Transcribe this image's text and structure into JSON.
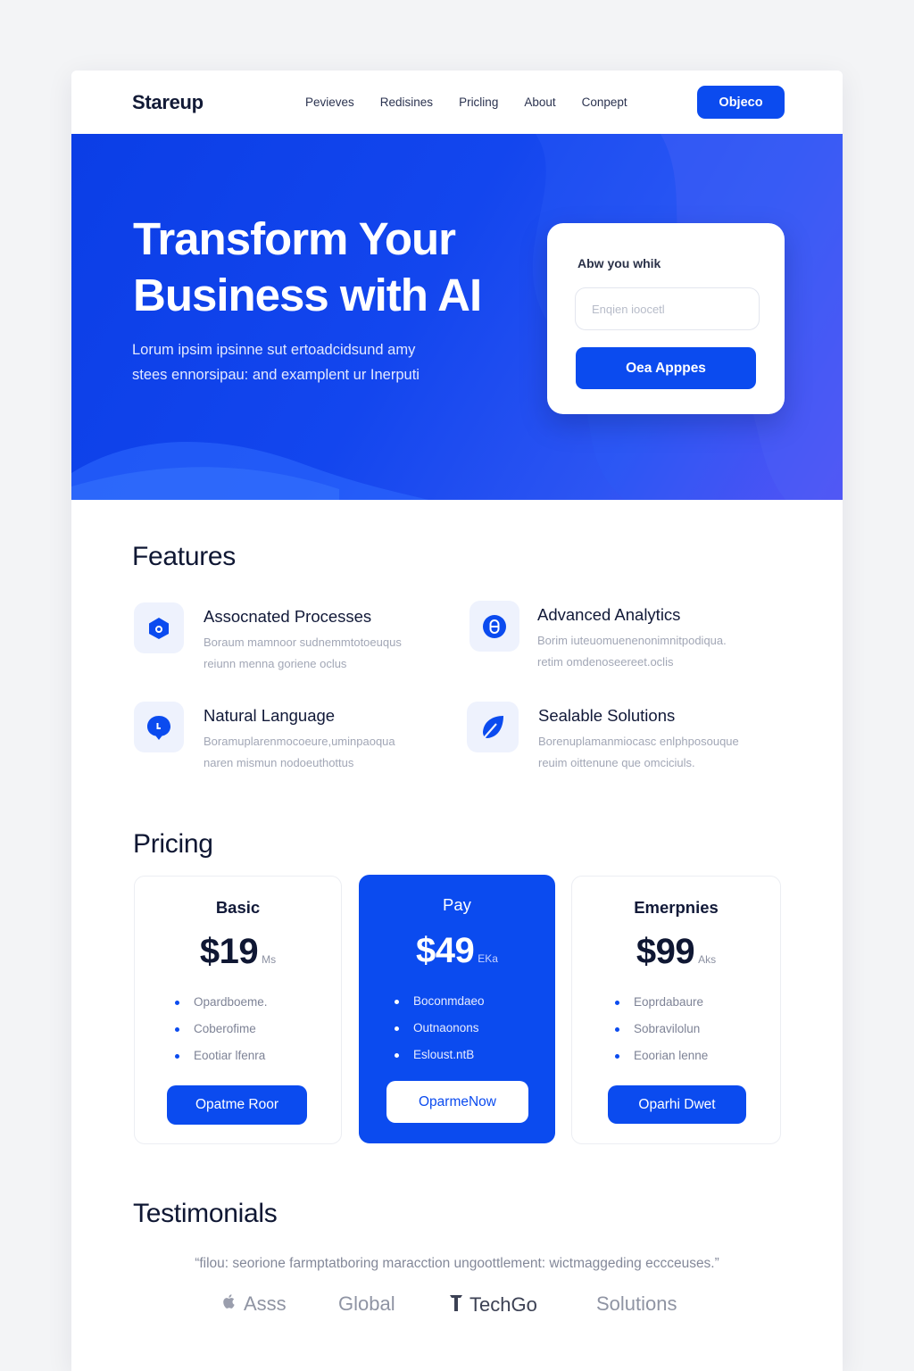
{
  "nav": {
    "brand": "Stareup",
    "links": [
      "Pevieves",
      "Redisines",
      "Pricling",
      "About",
      "Conpept"
    ],
    "cta": "Objeco"
  },
  "hero": {
    "title_line1": "Transform Your",
    "title_line2": "Business with AI",
    "subtitle_line1": "Lorum ipsim ipsinne sut ertoadcidsund amy",
    "subtitle_line2": "stees ennorsipau: and examplent ur Inerputi",
    "signup": {
      "label": "Abw you whik",
      "placeholder": "Enqien ioocetl",
      "button": "Oea Apppes"
    }
  },
  "features": {
    "title": "Features",
    "items": [
      {
        "title": "Assocnated Processes",
        "desc_line1": "Boraum mamnoor sudnemmtotoeuqus",
        "desc_line2": "reiunn menna goriene oclus",
        "icon": "hexagon-icon"
      },
      {
        "title": "Advanced Analytics",
        "desc_line1": "Borim iuteuomuenenonimnitpodiqua.",
        "desc_line2": "retim omdenoseereet.oclis",
        "icon": "analytics-icon"
      },
      {
        "title": "Natural Language",
        "desc_line1": "Boramuplarenmocoeure,uminpaoqua",
        "desc_line2": "naren mismun nodoeuthottus",
        "icon": "speech-icon"
      },
      {
        "title": "Sealable Solutions",
        "desc_line1": "Borenuplamanmiocasc enlphposouque",
        "desc_line2": "reuim oittenune que omciciuls.",
        "icon": "leaf-icon"
      }
    ]
  },
  "pricing": {
    "title": "Pricing",
    "plans": [
      {
        "name": "Basic",
        "price": "$19",
        "period": "Ms",
        "features": [
          "Opardboeme.",
          "Coberofime",
          "Eootiar lfenra"
        ],
        "button": "Opatme Roor",
        "featured": false
      },
      {
        "name": "Pay",
        "price": "$49",
        "period": "EKa",
        "features": [
          "Boconmdaeo",
          "Outnaonons",
          "Esloust.ntB"
        ],
        "button": "OparmeNow",
        "featured": true
      },
      {
        "name": "Emerpnies",
        "price": "$99",
        "period": "Aks",
        "features": [
          "Eoprdabaure",
          "Sobravilolun",
          "Eoorian lenne"
        ],
        "button": "Oparhi Dwet",
        "featured": false
      }
    ]
  },
  "testimonials": {
    "title": "Testimonials",
    "quote": "“filou: seorione farmptatboring maracction ungoottlement: wictmaggeding eccceuses.”",
    "logos": [
      "Asss",
      "Global",
      "TechGo",
      "Solutions"
    ]
  },
  "colors": {
    "primary": "#0b4bef",
    "hero_gradient_start": "#0b3ee6",
    "hero_gradient_end": "#6a4ef4",
    "text_dark": "#0f1733",
    "text_muted": "#a2a7b6"
  }
}
